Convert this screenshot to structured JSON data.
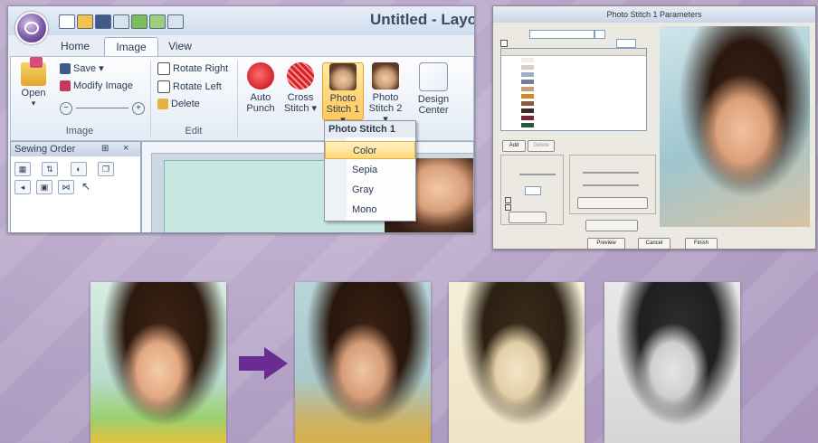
{
  "app": {
    "window_title": "Untitled - Layo",
    "tabs": [
      "Home",
      "Image",
      "View"
    ],
    "active_tab": "Image",
    "ribbon": {
      "image_group": {
        "label": "Image",
        "open_label": "Open",
        "save_label": "Save",
        "modify_label": "Modify Image"
      },
      "edit_group": {
        "label": "Edit",
        "rotate_right_label": "Rotate Right",
        "rotate_left_label": "Rotate Left",
        "delete_label": "Delete"
      },
      "buttons": [
        {
          "line1": "Auto",
          "line2": "Punch"
        },
        {
          "line1": "Cross",
          "line2": "Stitch"
        },
        {
          "line1": "Photo",
          "line2": "Stitch 1"
        },
        {
          "line1": "Photo",
          "line2": "Stitch 2"
        },
        {
          "line1": "Design",
          "line2": "Center"
        }
      ]
    },
    "sewing_order": {
      "title": "Sewing Order"
    },
    "dropdown": {
      "header": "Photo Stitch 1",
      "items": [
        "Color",
        "Sepia",
        "Gray",
        "Mono"
      ],
      "selected": "Color"
    }
  },
  "dialog": {
    "title": "Photo Stitch 1 Parameters",
    "buttons": [
      "Add",
      "Delete",
      "Preview",
      "Cancel",
      "Finish"
    ]
  },
  "colors": {
    "accent_purple": "#6a2c91",
    "highlight": "#ffd97a"
  }
}
